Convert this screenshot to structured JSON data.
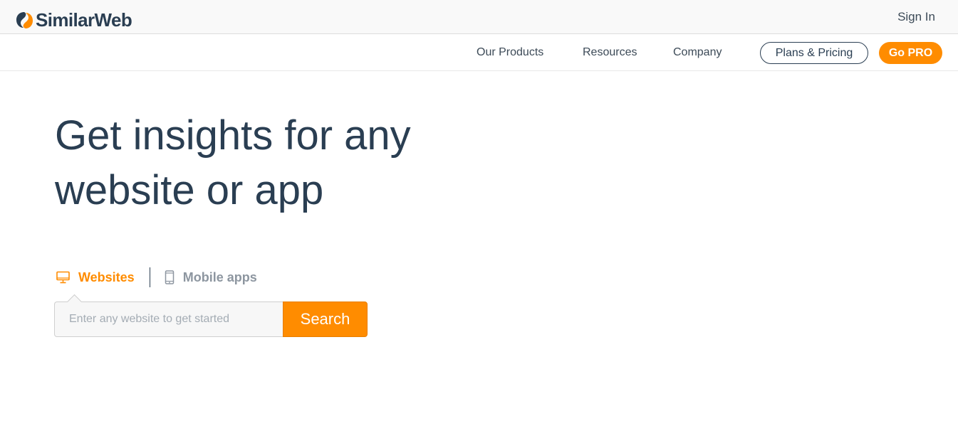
{
  "brand": {
    "name": "SimilarWeb",
    "logo_icon": "similarweb-logo-icon",
    "colors": {
      "navy": "#2a3e52",
      "orange": "#ff8c00"
    }
  },
  "header": {
    "sign_in_label": "Sign In"
  },
  "nav": {
    "items": [
      {
        "label": "Our Products"
      },
      {
        "label": "Resources"
      },
      {
        "label": "Company"
      }
    ],
    "plans_label": "Plans & Pricing",
    "go_pro_label": "Go PRO"
  },
  "hero": {
    "headline_line1": "Get insights for any",
    "headline_line2": "website or app"
  },
  "tabs": [
    {
      "label": "Websites",
      "icon": "desktop-icon",
      "active": true
    },
    {
      "label": "Mobile apps",
      "icon": "mobile-phone-icon",
      "active": false
    }
  ],
  "search": {
    "placeholder": "Enter any website to get started",
    "value": "",
    "button_label": "Search"
  }
}
